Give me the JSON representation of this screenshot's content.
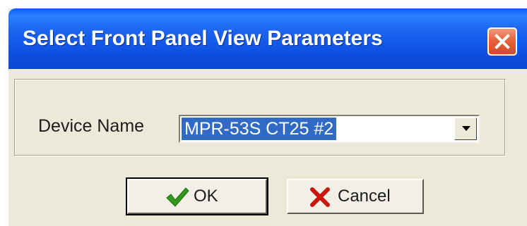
{
  "window": {
    "title": "Select Front Panel View Parameters",
    "close_icon": "close-icon"
  },
  "form": {
    "device_name_label": "Device Name",
    "device_name_value": "MPR-53S CT25 #2"
  },
  "buttons": {
    "ok_label": "OK",
    "ok_icon": "checkmark-icon",
    "cancel_label": "Cancel",
    "cancel_icon": "x-icon"
  },
  "colors": {
    "titlebar": "#0f4fe0",
    "selection": "#316ac5",
    "close_button": "#e5633c",
    "ok_check": "#2f9a1e",
    "cancel_x": "#c8180c"
  }
}
